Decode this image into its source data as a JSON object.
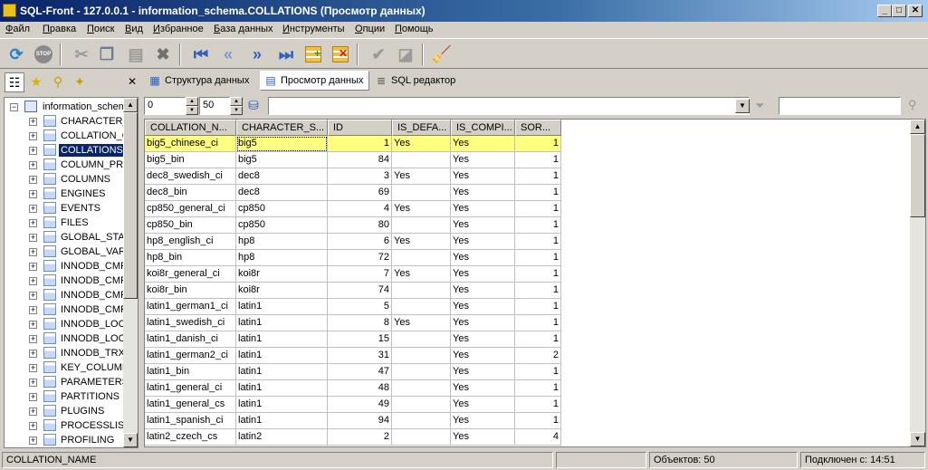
{
  "window": {
    "title": "SQL-Front - 127.0.0.1 - information_schema.COLLATIONS  (Просмотр данных)"
  },
  "menu": [
    "Файл",
    "Правка",
    "Поиск",
    "Вид",
    "Избранное",
    "База данных",
    "Инструменты",
    "Опции",
    "Помощь"
  ],
  "tabs": [
    {
      "label": "Структура данных",
      "active": false
    },
    {
      "label": "Просмотр данных",
      "active": true
    },
    {
      "label": "SQL редактор",
      "active": false
    }
  ],
  "tree": {
    "root": "information_schema",
    "items": [
      "CHARACTER_SETS",
      "COLLATION_CHARACTER_SET_APPLICABILITY",
      "COLLATIONS",
      "COLUMN_PRIVILEGES",
      "COLUMNS",
      "ENGINES",
      "EVENTS",
      "FILES",
      "GLOBAL_STATUS",
      "GLOBAL_VARIABLES",
      "INNODB_CMP",
      "INNODB_CMP_RESET",
      "INNODB_CMPMEM",
      "INNODB_CMPMEM_RESET",
      "INNODB_LOCK_WAITS",
      "INNODB_LOCKS",
      "INNODB_TRX",
      "KEY_COLUMN_USAGE",
      "PARAMETERS",
      "PARTITIONS",
      "PLUGINS",
      "PROCESSLIST",
      "PROFILING"
    ],
    "selected": "COLLATIONS"
  },
  "filter": {
    "offset": "0",
    "limit": "50"
  },
  "grid": {
    "columns": [
      "COLLATION_N...",
      "CHARACTER_S...",
      "ID",
      "IS_DEFA...",
      "IS_COMPI...",
      "SOR..."
    ],
    "rows": [
      [
        "big5_chinese_ci",
        "big5",
        "1",
        "Yes",
        "Yes",
        "1"
      ],
      [
        "big5_bin",
        "big5",
        "84",
        "",
        "Yes",
        "1"
      ],
      [
        "dec8_swedish_ci",
        "dec8",
        "3",
        "Yes",
        "Yes",
        "1"
      ],
      [
        "dec8_bin",
        "dec8",
        "69",
        "",
        "Yes",
        "1"
      ],
      [
        "cp850_general_ci",
        "cp850",
        "4",
        "Yes",
        "Yes",
        "1"
      ],
      [
        "cp850_bin",
        "cp850",
        "80",
        "",
        "Yes",
        "1"
      ],
      [
        "hp8_english_ci",
        "hp8",
        "6",
        "Yes",
        "Yes",
        "1"
      ],
      [
        "hp8_bin",
        "hp8",
        "72",
        "",
        "Yes",
        "1"
      ],
      [
        "koi8r_general_ci",
        "koi8r",
        "7",
        "Yes",
        "Yes",
        "1"
      ],
      [
        "koi8r_bin",
        "koi8r",
        "74",
        "",
        "Yes",
        "1"
      ],
      [
        "latin1_german1_ci",
        "latin1",
        "5",
        "",
        "Yes",
        "1"
      ],
      [
        "latin1_swedish_ci",
        "latin1",
        "8",
        "Yes",
        "Yes",
        "1"
      ],
      [
        "latin1_danish_ci",
        "latin1",
        "15",
        "",
        "Yes",
        "1"
      ],
      [
        "latin1_german2_ci",
        "latin1",
        "31",
        "",
        "Yes",
        "2"
      ],
      [
        "latin1_bin",
        "latin1",
        "47",
        "",
        "Yes",
        "1"
      ],
      [
        "latin1_general_ci",
        "latin1",
        "48",
        "",
        "Yes",
        "1"
      ],
      [
        "latin1_general_cs",
        "latin1",
        "49",
        "",
        "Yes",
        "1"
      ],
      [
        "latin1_spanish_ci",
        "latin1",
        "94",
        "",
        "Yes",
        "1"
      ],
      [
        "latin2_czech_cs",
        "latin2",
        "2",
        "",
        "Yes",
        "4"
      ]
    ]
  },
  "status": {
    "field": "COLLATION_NAME",
    "objects": "Объектов: 50",
    "connected": "Подключен с: 14:51"
  },
  "colors": {
    "title_start": "#0a246a",
    "title_end": "#a6caf0",
    "row_highlight": "#ffff80",
    "selection": "#0a246a"
  }
}
